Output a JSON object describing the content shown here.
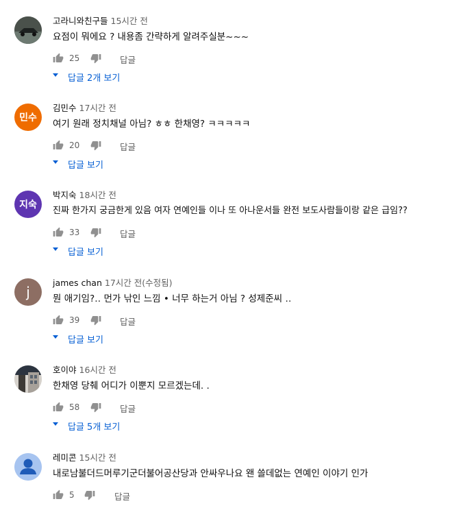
{
  "comments": [
    {
      "author": "고라니와친구들",
      "time": "15시간 전",
      "text": "요점이 뭐에요 ? 내용좀 간략하게 알려주실분~~~",
      "likes": "25",
      "reply_label": "답글",
      "replies_label": "답글 2개 보기",
      "avatar": {
        "type": "photo",
        "colors": [
          "#3b3f3a",
          "#6d7a72"
        ]
      }
    },
    {
      "author": "김민수",
      "time": "17시간 전",
      "text": "여기 원래 정치채널 아님? ㅎㅎ 한채영? ㅋㅋㅋㅋㅋ",
      "likes": "20",
      "reply_label": "답글",
      "replies_label": "답글 보기",
      "avatar": {
        "type": "initials",
        "initials": "민수",
        "color": "#ef6c00"
      }
    },
    {
      "author": "박지숙",
      "time": "18시간 전",
      "text": "진짜 한가지 궁금한게 있음 여자 연예인들 이나 또 아나운서들 완전  보도사람들이랑 같은 급임??",
      "likes": "33",
      "reply_label": "답글",
      "replies_label": "답글 보기",
      "avatar": {
        "type": "initials",
        "initials": "지숙",
        "color": "#5e35b1"
      }
    },
    {
      "author": "james chan",
      "time": "17시간 전(수정됨)",
      "text": "뭔 애기임?‥  먼가  낚인 느낌 •  너무  하는거 아님 ? 성제준씨 ‥",
      "likes": "39",
      "reply_label": "답글",
      "replies_label": "답글 보기",
      "avatar": {
        "type": "initials",
        "initials": "j",
        "color": "#8d6e63"
      }
    },
    {
      "author": "호이야",
      "time": "16시간 전",
      "text": "한채영 당췌 어디가 이뿐지 모르겠는데. .",
      "likes": "58",
      "reply_label": "답글",
      "replies_label": "답글 5개 보기",
      "avatar": {
        "type": "photo",
        "colors": [
          "#2c3440",
          "#c9c4bd"
        ]
      }
    },
    {
      "author": "레미콘",
      "time": "15시간 전",
      "text": "내로남불더드머루기군더불어공산당과  안싸우나요  왠  쓸데없는  연예인  이야기  인가",
      "likes": "5",
      "reply_label": "답글",
      "replies_label": "",
      "avatar": {
        "type": "default",
        "color": "#a7c4f0"
      }
    }
  ]
}
